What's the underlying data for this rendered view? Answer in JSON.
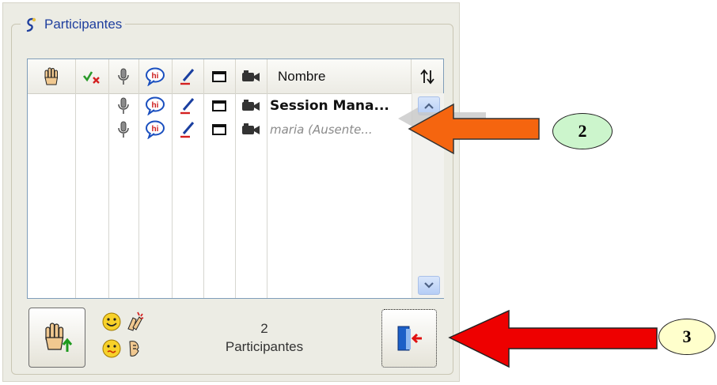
{
  "panel": {
    "title": "Participantes",
    "columns": {
      "name_header": "Nombre"
    },
    "participants": [
      {
        "name": "Session Mana...",
        "style": "bold"
      },
      {
        "name": "maria (Ausente...",
        "style": "italic-gray"
      }
    ],
    "footer": {
      "count": "2",
      "count_label": "Participantes"
    }
  },
  "annotations": {
    "callout_2": "2",
    "callout_3": "3"
  },
  "colors": {
    "arrow_orange": "#f5650f",
    "arrow_red": "#ee0000",
    "circle_2_fill": "#ccf5cc",
    "circle_3_fill": "#ffffcc",
    "legend_text": "#1f3f9e",
    "scroll_button": "#b5cdf6"
  }
}
